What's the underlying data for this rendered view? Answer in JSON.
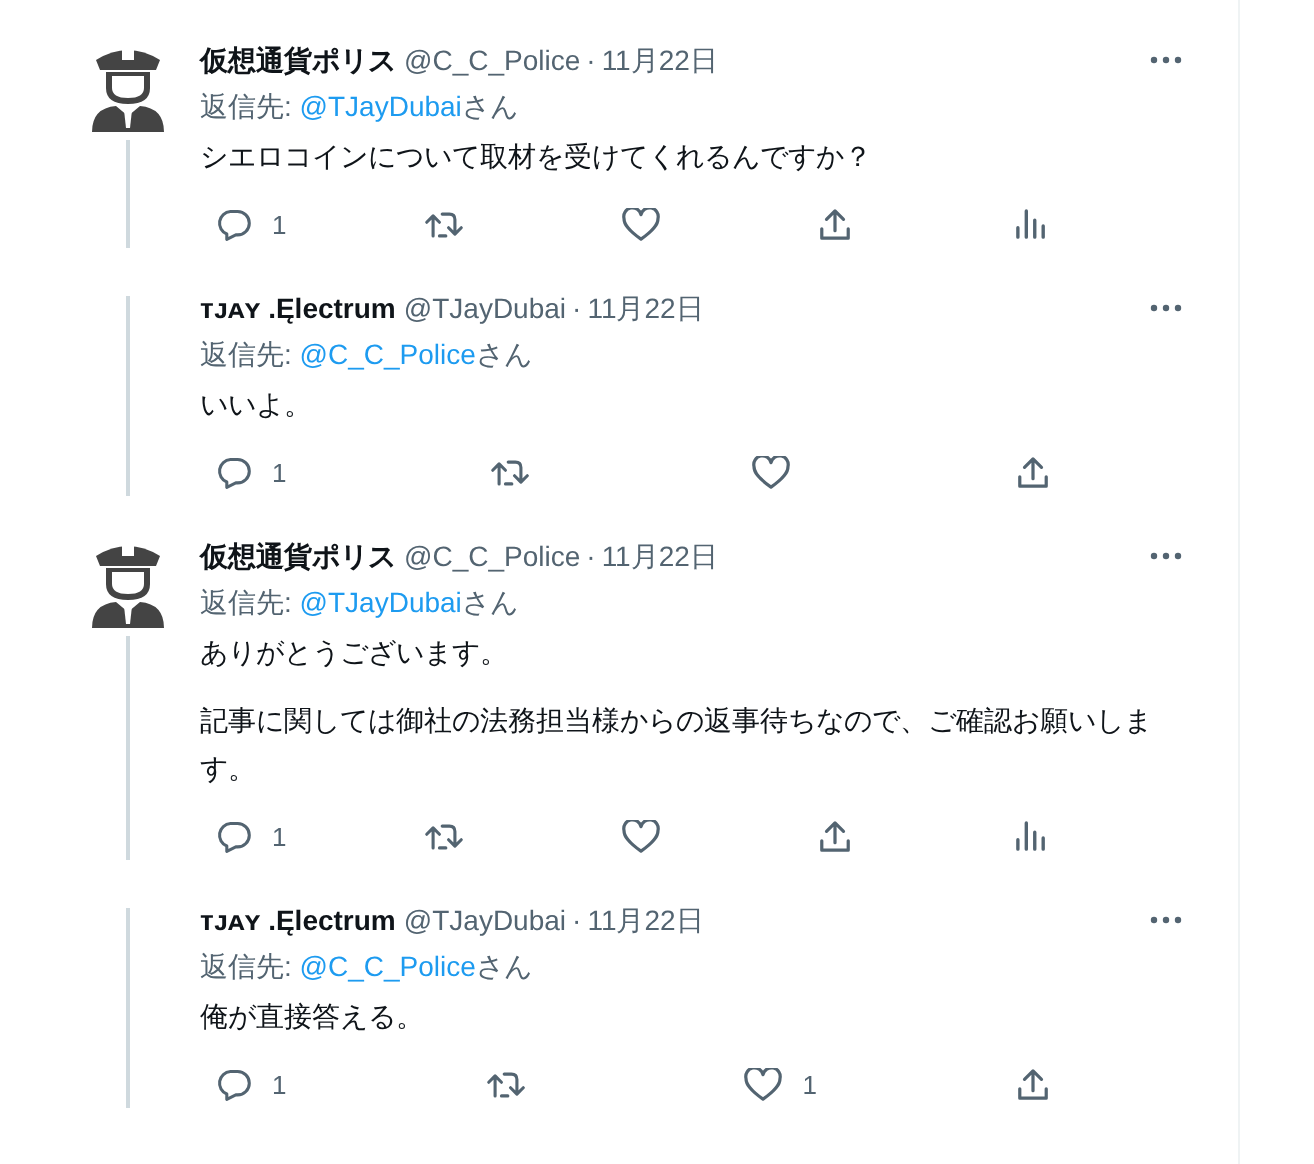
{
  "tweets": [
    {
      "kind": "with_avatar",
      "name": "仮想通貨ポリス",
      "handle": "@C_C_Police",
      "separator": "·",
      "date": "11月22日",
      "reply_prefix": "返信先: ",
      "reply_to": "@TJayDubai",
      "reply_suffix": "さん",
      "paragraphs": [
        "シエロコインについて取材を受けてくれるんですか？"
      ],
      "actions": [
        {
          "kind": "reply",
          "count": "1"
        },
        {
          "kind": "retweet"
        },
        {
          "kind": "like"
        },
        {
          "kind": "share"
        },
        {
          "kind": "analytics"
        }
      ]
    },
    {
      "kind": "plain",
      "name": "ᴛᴊᴀʏ .Ęlectrum",
      "handle": "@TJayDubai",
      "separator": "·",
      "date": "11月22日",
      "reply_prefix": "返信先: ",
      "reply_to": "@C_C_Police",
      "reply_suffix": "さん",
      "paragraphs": [
        "いいよ。"
      ],
      "actions": [
        {
          "kind": "reply",
          "count": "1"
        },
        {
          "kind": "retweet"
        },
        {
          "kind": "like"
        },
        {
          "kind": "share"
        }
      ]
    },
    {
      "kind": "with_avatar",
      "name": "仮想通貨ポリス",
      "handle": "@C_C_Police",
      "separator": "·",
      "date": "11月22日",
      "reply_prefix": "返信先: ",
      "reply_to": "@TJayDubai",
      "reply_suffix": "さん",
      "paragraphs": [
        "ありがとうございます。",
        "記事に関しては御社の法務担当様からの返事待ちなので、ご確認お願いします。"
      ],
      "actions": [
        {
          "kind": "reply",
          "count": "1"
        },
        {
          "kind": "retweet"
        },
        {
          "kind": "like"
        },
        {
          "kind": "share"
        },
        {
          "kind": "analytics"
        }
      ]
    },
    {
      "kind": "plain",
      "name": "ᴛᴊᴀʏ .Ęlectrum",
      "handle": "@TJayDubai",
      "separator": "·",
      "date": "11月22日",
      "reply_prefix": "返信先: ",
      "reply_to": "@C_C_Police",
      "reply_suffix": "さん",
      "paragraphs": [
        "俺が直接答える。"
      ],
      "actions": [
        {
          "kind": "reply",
          "count": "1"
        },
        {
          "kind": "retweet"
        },
        {
          "kind": "like",
          "count": "1"
        },
        {
          "kind": "share"
        }
      ]
    }
  ]
}
